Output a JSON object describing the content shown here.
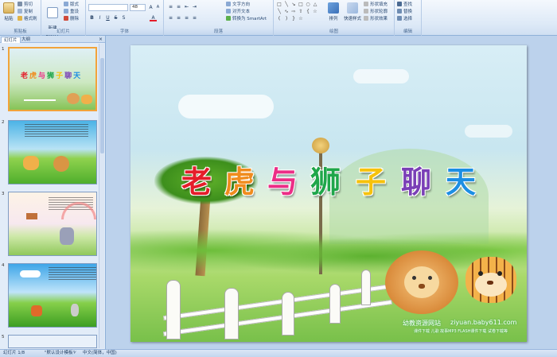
{
  "ribbon": {
    "clipboard": {
      "paste": "粘贴",
      "cut": "剪切",
      "copy": "复制",
      "format_painter": "格式刷",
      "label": "剪贴板"
    },
    "slides": {
      "new_slide": "新建\n幻灯片",
      "layout": "版式",
      "reset": "重设",
      "delete": "删除",
      "label": "幻灯片"
    },
    "font": {
      "size_value": "48",
      "label": "字体"
    },
    "paragraph": {
      "text_direction": "文字方向",
      "align_text": "对齐文本",
      "smartart": "转换为 SmartArt",
      "label": "段落"
    },
    "drawing": {
      "arrange": "排列",
      "quick_styles": "快速样式",
      "shape_fill": "形状填充",
      "shape_outline": "形状轮廓",
      "shape_effects": "形状效果",
      "label": "绘图"
    },
    "editing": {
      "find": "查找",
      "replace": "替换",
      "select": "选择",
      "label": "编辑"
    }
  },
  "left_pane": {
    "tabs": [
      "幻灯片",
      "大纲"
    ],
    "close": "×",
    "slide_numbers": [
      "1",
      "2",
      "3",
      "4",
      "5"
    ]
  },
  "slide": {
    "title_chars": [
      "老",
      "虎",
      "与",
      "狮",
      "子",
      "聊",
      "天"
    ],
    "title_colors": [
      "#e51d2a",
      "#f08c1e",
      "#ec2d86",
      "#1fa64a",
      "#f6c20c",
      "#7a3fb6",
      "#1c8ee3"
    ],
    "site_name": "幼教资源网站",
    "site_url": "ziyuan.baby611.com",
    "site_links": "课件下载  儿歌  故事MP3  FLASH课件下载  试卷下载等"
  },
  "status_bar": {
    "slide_info": "幻灯片 1/8",
    "theme": "\"默认设计模板\"",
    "language": "中文(简体，中国)"
  },
  "colors": {
    "accent": "#f2a33a",
    "ribbon_border": "#8fb1d8"
  }
}
